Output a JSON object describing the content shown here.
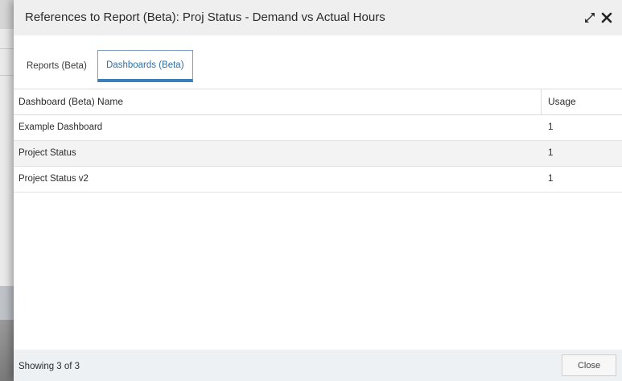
{
  "dialog": {
    "title": "References to Report (Beta): Proj Status - Demand vs Actual Hours",
    "expand_icon": "expand-icon",
    "close_icon": "close-icon"
  },
  "tabs": [
    {
      "label": "Reports (Beta)",
      "active": false
    },
    {
      "label": "Dashboards (Beta)",
      "active": true
    }
  ],
  "table": {
    "columns": [
      "Dashboard (Beta) Name",
      "Usage"
    ],
    "rows": [
      {
        "name": "Example Dashboard",
        "usage": "1"
      },
      {
        "name": "Project Status",
        "usage": "1"
      },
      {
        "name": "Project Status v2",
        "usage": "1"
      }
    ]
  },
  "footer": {
    "status": "Showing 3 of 3",
    "close_label": "Close"
  },
  "colors": {
    "accent": "#3c7fb7",
    "header_bg": "#efefef",
    "footer_bg": "#eef1f4"
  }
}
